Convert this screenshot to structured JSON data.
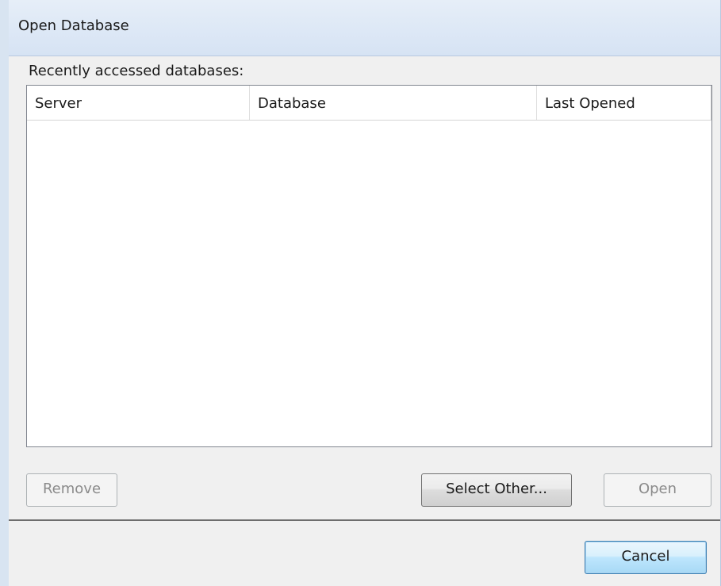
{
  "window": {
    "title": "Open Database"
  },
  "recent": {
    "label": "Recently accessed databases:",
    "columns": [
      "Server",
      "Database",
      "Last Opened"
    ],
    "rows": []
  },
  "buttons": {
    "remove": "Remove",
    "select_other": "Select Other...",
    "open": "Open",
    "cancel": "Cancel"
  },
  "colors": {
    "title_bar": "#d6e3f4",
    "default_button_border": "#3c7fb1",
    "disabled_text": "#8b8b8b"
  }
}
